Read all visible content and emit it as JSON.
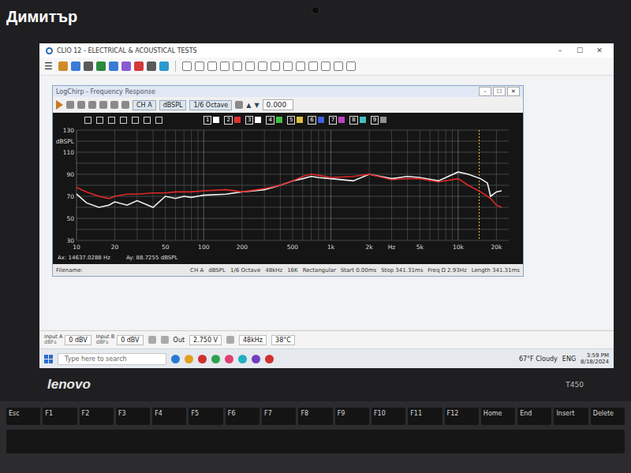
{
  "watermark": "Димитър",
  "window": {
    "title": "CLIO 12 - ELECTRICAL & ACOUSTICAL TESTS",
    "menu_icon": "☰",
    "controls": [
      "–",
      "☐",
      "✕"
    ]
  },
  "inner_window": {
    "title": "LogChirp - Frequency Response",
    "controls": [
      "–",
      "☐",
      "✕"
    ],
    "toolbar": {
      "channel": "CH A",
      "unit": "dBSPL",
      "smoothing": "1/6 Octave",
      "arrows": [
        "▲",
        "▼"
      ],
      "value": "0.000"
    },
    "overlays": [
      {
        "label": "1",
        "color": "#ffffff"
      },
      {
        "label": "2",
        "color": "#e03030"
      },
      {
        "label": "3",
        "color": "#ffffff"
      },
      {
        "label": "4",
        "color": "#40c040"
      },
      {
        "label": "5",
        "color": "#e0c040"
      },
      {
        "label": "6",
        "color": "#4060e0"
      },
      {
        "label": "7",
        "color": "#c040c0"
      },
      {
        "label": "8",
        "color": "#40c0c0"
      },
      {
        "label": "9",
        "color": "#909090"
      }
    ],
    "chart": {
      "y_min": 30,
      "y_max": 130,
      "x_min_hz": 10,
      "x_max_hz": 25000,
      "y_ticks": [
        {
          "label": "130",
          "value": 130
        },
        {
          "label": "dBSPL",
          "value": 120
        },
        {
          "label": "110",
          "value": 110
        },
        {
          "label": "90",
          "value": 90
        },
        {
          "label": "70",
          "value": 70
        },
        {
          "label": "50",
          "value": 50
        },
        {
          "label": "30",
          "value": 30
        }
      ],
      "x_ticks": [
        {
          "label": "10",
          "hz": 10
        },
        {
          "label": "20",
          "hz": 20
        },
        {
          "label": "50",
          "hz": 50
        },
        {
          "label": "100",
          "hz": 100
        },
        {
          "label": "200",
          "hz": 200
        },
        {
          "label": "500",
          "hz": 500
        },
        {
          "label": "1k",
          "hz": 1000
        },
        {
          "label": "2k",
          "hz": 2000
        },
        {
          "label": "Hz",
          "hz": 3000
        },
        {
          "label": "5k",
          "hz": 5000
        },
        {
          "label": "10k",
          "hz": 10000
        },
        {
          "label": "20k",
          "hz": 20000
        }
      ],
      "frequencies_hz": [
        10,
        12,
        15,
        18,
        20,
        25,
        30,
        40,
        50,
        60,
        70,
        80,
        100,
        150,
        200,
        300,
        400,
        500,
        600,
        700,
        800,
        1000,
        1500,
        2000,
        3000,
        4000,
        5000,
        7000,
        10000,
        12000,
        15000,
        17000,
        18000,
        20000,
        22000
      ],
      "series": [
        {
          "color": "#f2f2f2",
          "values": [
            72,
            64,
            60,
            62,
            65,
            62,
            66,
            60,
            70,
            68,
            70,
            69,
            71,
            72,
            74,
            76,
            80,
            84,
            86,
            88,
            87,
            86,
            84,
            90,
            86,
            88,
            87,
            84,
            92,
            90,
            86,
            82,
            70,
            74,
            75
          ]
        },
        {
          "color": "#e02828",
          "values": [
            78,
            74,
            70,
            68,
            70,
            72,
            72,
            73,
            73,
            74,
            74,
            74,
            75,
            76,
            74,
            77,
            80,
            84,
            88,
            90,
            89,
            87,
            88,
            90,
            85,
            86,
            86,
            83,
            86,
            80,
            74,
            70,
            68,
            62,
            60
          ]
        }
      ],
      "cursor_hz": 14637
    },
    "cursor_readout": {
      "ax": "Ax: 14637.0288 Hz",
      "ay": "Ay: 88.7255 dBSPL"
    },
    "info_bar": {
      "label": "Filename:",
      "fields": [
        "CH A",
        "dBSPL",
        "1/6 Octave",
        "48kHz",
        "16K",
        "Rectangular",
        "Start 0.00ms",
        "Stop 341.31ms",
        "Freq Ω 2.93Hz",
        "Length 341.31ms"
      ]
    }
  },
  "status_bar": {
    "inputs": [
      {
        "label": "Input A",
        "unit": "dBFs",
        "value": "0 dBV"
      },
      {
        "label": "Input B",
        "unit": "dBFs",
        "value": "0 dBV"
      }
    ],
    "output": {
      "label": "Out",
      "value": "2.750 V"
    },
    "rate": "48kHz",
    "temperature": "38°C"
  },
  "taskbar": {
    "search_placeholder": "Type here to search",
    "weather": "67°F Cloudy",
    "language": "ENG",
    "time": "3:59 PM",
    "date": "8/18/2024"
  },
  "laptop": {
    "brand": "lenovo",
    "model": "T450",
    "keys": [
      "Esc",
      "F1",
      "F2",
      "F3",
      "F4",
      "F5",
      "F6",
      "F7",
      "F8",
      "F9",
      "F10",
      "F11",
      "F12",
      "Home",
      "End",
      "Insert",
      "Delete"
    ]
  }
}
